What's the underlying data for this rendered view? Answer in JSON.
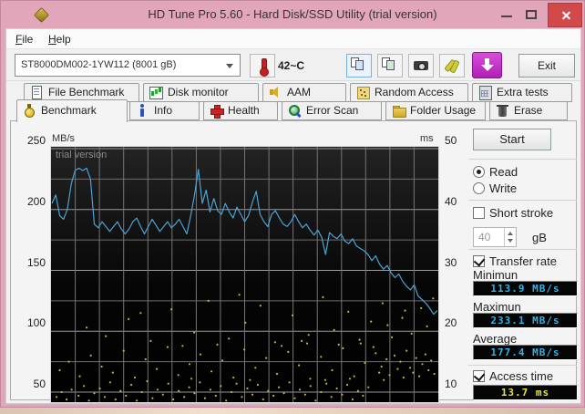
{
  "window": {
    "title": "HD Tune Pro 5.60 - Hard Disk/SSD Utility (trial version)"
  },
  "menu": {
    "items": [
      {
        "label": "File"
      },
      {
        "label": "Help"
      }
    ]
  },
  "toolbar": {
    "drive_selector_value": "ST8000DM002-1YW112 (8001 gB)",
    "temperature": "42~C",
    "exit_label": "Exit"
  },
  "tabs": {
    "active": "Benchmark",
    "row1": [
      {
        "label": "File Benchmark"
      },
      {
        "label": "Disk monitor"
      },
      {
        "label": "AAM"
      },
      {
        "label": "Random Access"
      },
      {
        "label": "Extra tests"
      }
    ],
    "row2": [
      {
        "label": "Benchmark"
      },
      {
        "label": "Info"
      },
      {
        "label": "Health"
      },
      {
        "label": "Error Scan"
      },
      {
        "label": "Folder Usage"
      },
      {
        "label": "Erase"
      }
    ]
  },
  "controls": {
    "start_label": "Start",
    "read_label": "Read",
    "write_label": "Write",
    "mode_selected": "Read",
    "short_stroke_label": "Short stroke",
    "short_stroke_checked": false,
    "short_stroke_size": "40",
    "short_stroke_unit": "gB",
    "transfer_rate_label": "Transfer rate",
    "transfer_rate_checked": true,
    "minimum_label": "Minimun",
    "minimum_value": "113.9 MB/s",
    "maximum_label": "Maximun",
    "maximum_value": "233.1 MB/s",
    "average_label": "Average",
    "average_value": "177.4 MB/s",
    "access_time_label": "Access time",
    "access_time_checked": true,
    "access_time_value": "13.7 ms"
  },
  "chart_data": {
    "type": "line",
    "watermark": "trial version",
    "grid": {
      "v_divisions": 16,
      "h_step": 25,
      "on": true
    },
    "left_axis": {
      "label": "MB/s",
      "ticks": [
        250,
        200,
        150,
        100,
        50
      ],
      "range": [
        42,
        250
      ]
    },
    "right_axis": {
      "label": "ms",
      "ticks": [
        50,
        40,
        30,
        20,
        10
      ],
      "range": [
        8.4,
        50
      ]
    },
    "series": [
      {
        "name": "Transfer rate",
        "unit": "MB/s",
        "color": "#4aa4d4",
        "x_unit": "percent of disk (0-100)",
        "values": [
          205,
          212,
          195,
          192,
          200,
          221,
          232,
          234,
          232,
          234,
          225,
          188,
          185,
          190,
          186,
          182,
          186,
          190,
          184,
          180,
          184,
          190,
          193,
          186,
          180,
          186,
          192,
          187,
          182,
          186,
          190,
          185,
          188,
          192,
          186,
          180,
          195,
          212,
          233,
          205,
          216,
          198,
          209,
          199,
          196,
          205,
          198,
          193,
          202,
          196,
          190,
          195,
          206,
          215,
          196,
          190,
          186,
          196,
          199,
          193,
          188,
          186,
          190,
          196,
          190,
          185,
          188,
          183,
          179,
          183,
          177,
          163,
          181,
          178,
          176,
          180,
          174,
          172,
          176,
          170,
          168,
          166,
          163,
          158,
          162,
          155,
          151,
          154,
          148,
          144,
          147,
          141,
          137,
          134,
          138,
          129,
          126,
          123,
          119,
          114,
          117
        ]
      },
      {
        "name": "Access time",
        "unit": "ms",
        "axis": "right",
        "color": "#b6b64a",
        "points": [
          [
            1.2,
            9.2
          ],
          [
            2.5,
            10
          ],
          [
            3.8,
            8.8
          ],
          [
            5.1,
            10.4
          ],
          [
            6.9,
            9.4
          ],
          [
            8.3,
            11
          ],
          [
            9.6,
            8.6
          ],
          [
            11,
            9.8
          ],
          [
            12.4,
            10.6
          ],
          [
            13.7,
            9.2
          ],
          [
            15.1,
            11.6
          ],
          [
            16.5,
            8.8
          ],
          [
            17.8,
            10.2
          ],
          [
            19.2,
            9.4
          ],
          [
            20.6,
            11.2
          ],
          [
            22,
            8.6
          ],
          [
            23.3,
            10
          ],
          [
            24.7,
            11.8
          ],
          [
            26.1,
            9
          ],
          [
            27.4,
            10.4
          ],
          [
            28.8,
            9.6
          ],
          [
            30.2,
            11.4
          ],
          [
            31.5,
            8.8
          ],
          [
            32.9,
            10.2
          ],
          [
            34.3,
            9.2
          ],
          [
            35.6,
            10.8
          ],
          [
            37,
            9.8
          ],
          [
            38.4,
            11.6
          ],
          [
            39.7,
            9
          ],
          [
            41.1,
            10.4
          ],
          [
            42.5,
            9.4
          ],
          [
            43.8,
            11
          ],
          [
            45.2,
            8.6
          ],
          [
            46.6,
            10
          ],
          [
            47.9,
            11.4
          ],
          [
            49.3,
            9.2
          ],
          [
            50.7,
            10.6
          ],
          [
            52,
            9.6
          ],
          [
            53.4,
            11.2
          ],
          [
            54.8,
            8.8
          ],
          [
            56.1,
            10.2
          ],
          [
            57.5,
            9.4
          ],
          [
            58.9,
            10.8
          ],
          [
            60.2,
            9.8
          ],
          [
            61.6,
            11.6
          ],
          [
            63,
            9
          ],
          [
            64.3,
            10.4
          ],
          [
            65.7,
            9.6
          ],
          [
            67.1,
            11
          ],
          [
            68.4,
            8.6
          ],
          [
            69.8,
            10
          ],
          [
            71.2,
            11.4
          ],
          [
            72.5,
            9.2
          ],
          [
            73.9,
            10.6
          ],
          [
            75.3,
            9.6
          ],
          [
            76.6,
            11.2
          ],
          [
            78,
            8.8
          ],
          [
            79.4,
            10.2
          ],
          [
            80.7,
            9.4
          ],
          [
            82.1,
            10.8
          ],
          [
            2,
            13.6
          ],
          [
            4.4,
            15
          ],
          [
            7.2,
            12.6
          ],
          [
            10.1,
            16
          ],
          [
            12.9,
            14.2
          ],
          [
            15.8,
            13.2
          ],
          [
            18.6,
            16.8
          ],
          [
            21.5,
            12.4
          ],
          [
            24.3,
            15.4
          ],
          [
            27.2,
            13.8
          ],
          [
            30,
            17.4
          ],
          [
            32.8,
            12.8
          ],
          [
            35.7,
            14.6
          ],
          [
            38.5,
            16.2
          ],
          [
            41.4,
            13.4
          ],
          [
            44.2,
            15.2
          ],
          [
            47.1,
            12.4
          ],
          [
            49.9,
            17
          ],
          [
            52.8,
            14
          ],
          [
            55.6,
            15.6
          ],
          [
            58.4,
            13
          ],
          [
            61.3,
            16.6
          ],
          [
            64.1,
            14.4
          ],
          [
            67,
            12.2
          ],
          [
            69.8,
            15.8
          ],
          [
            72.7,
            13.6
          ],
          [
            75.5,
            17.2
          ],
          [
            78.4,
            12.6
          ],
          [
            81.2,
            14.8
          ],
          [
            84,
            16.4
          ],
          [
            84.9,
            13.2
          ],
          [
            85.5,
            14.2
          ],
          [
            86.8,
            15.4
          ],
          [
            87.6,
            12.8
          ],
          [
            88.9,
            16
          ],
          [
            89.7,
            13.8
          ],
          [
            90.4,
            15
          ],
          [
            91.2,
            12.4
          ],
          [
            92,
            16.8
          ],
          [
            92.9,
            14
          ],
          [
            93.7,
            13.2
          ],
          [
            94.5,
            15.6
          ],
          [
            95.3,
            12.6
          ],
          [
            96.1,
            14.6
          ],
          [
            96.9,
            16.2
          ],
          [
            97.7,
            13.6
          ],
          [
            98.4,
            15.2
          ],
          [
            99.2,
            13
          ],
          [
            33.9,
            17.6
          ],
          [
            36.2,
            12.2
          ],
          [
            42.9,
            17.8
          ],
          [
            51.4,
            12
          ],
          [
            59.6,
            17.6
          ],
          [
            66.2,
            18
          ],
          [
            70.9,
            12
          ],
          [
            74.4,
            17.8
          ],
          [
            77.3,
            12.2
          ],
          [
            80.1,
            18
          ],
          [
            83.4,
            17.4
          ],
          [
            86.1,
            12
          ],
          [
            9,
            20.6
          ],
          [
            14,
            19.2
          ],
          [
            19.9,
            22
          ],
          [
            25.6,
            18.4
          ],
          [
            31,
            23.6
          ],
          [
            36.9,
            19.8
          ],
          [
            40.6,
            25
          ],
          [
            45.9,
            18.8
          ],
          [
            50.2,
            21.4
          ],
          [
            54.1,
            24.2
          ],
          [
            57.9,
            18.2
          ],
          [
            62.4,
            22.6
          ],
          [
            66.6,
            19.4
          ],
          [
            70.3,
            25.6
          ],
          [
            73.2,
            20.2
          ],
          [
            76.9,
            23.2
          ],
          [
            79.8,
            18.6
          ],
          [
            82.8,
            21.6
          ],
          [
            85.8,
            24.6
          ],
          [
            88.2,
            19
          ],
          [
            90.9,
            22.2
          ],
          [
            93.3,
            19.6
          ],
          [
            95.8,
            23.8
          ],
          [
            97.3,
            20.8
          ],
          [
            98.9,
            25.4
          ],
          [
            23,
            23
          ],
          [
            48.6,
            26
          ],
          [
            64.8,
            18.4
          ],
          [
            87.1,
            21
          ],
          [
            91.6,
            23.4
          ]
        ]
      }
    ]
  },
  "colors": {
    "titlebar": "#e2a6bb",
    "close_button": "#d2494a",
    "download_button": "#b81ec0",
    "lcd_cyan": "#2fb3e8",
    "lcd_yellow": "#e6e636",
    "plot_background": "#0a0a0a",
    "transfer_line": "#4aa4d4",
    "access_dots": "#b6b64a"
  }
}
